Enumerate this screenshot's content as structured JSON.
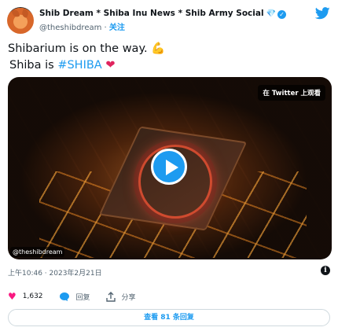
{
  "header": {
    "display_name": "Shib Dream * Shiba Inu News * Shib Army Social",
    "handle": "@theshibdream",
    "separator": " · ",
    "follow_label": "关注"
  },
  "tweet": {
    "line1": "Shibarium is on the way.",
    "line1_emoji": "💪",
    "line2_prefix": "Shiba is ",
    "hashtag": "#SHIBA",
    "line2_emoji": "❤"
  },
  "media": {
    "watch_on_twitter": "在 Twitter 上观看",
    "watermark_handle": "@theshibdream"
  },
  "meta": {
    "timestamp": "上午10:46 · 2023年2月21日"
  },
  "actions": {
    "like_count": "1,632",
    "reply_label": "回复",
    "share_label": "分享"
  },
  "footer": {
    "replies_button": "查看 81 条回复"
  },
  "colors": {
    "accent": "#1d9bf0",
    "like": "#f91880",
    "text": "#0f1419",
    "muted": "#536471"
  },
  "icons": [
    "avatar",
    "diamond-icon",
    "verified-badge-icon",
    "twitter-bird-icon",
    "play-icon",
    "info-icon",
    "heart-icon",
    "reply-icon",
    "share-icon"
  ]
}
